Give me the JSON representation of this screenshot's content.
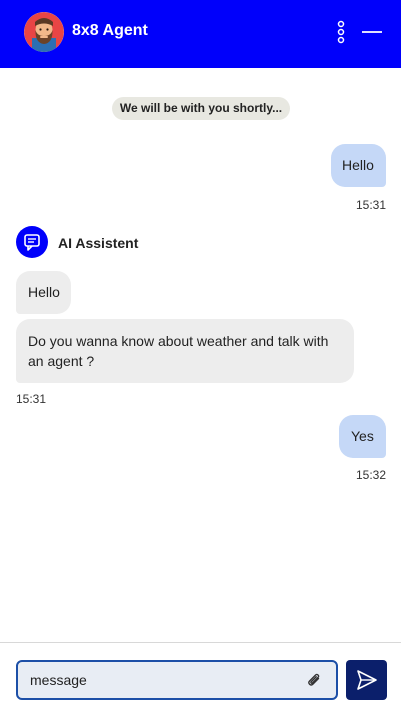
{
  "header": {
    "agent_name": "8x8 Agent",
    "avatar_icon": "bearded-man-avatar-icon",
    "menu_icon": "kebab-menu-icon",
    "minimize_icon": "minimize-icon",
    "background_color": "#0000fb"
  },
  "chat": {
    "system_message": "We will be with you shortly...",
    "messages": [
      {
        "direction": "outgoing",
        "text": "Hello",
        "time": "15:31"
      },
      {
        "direction": "incoming",
        "sender": "AI Assistent",
        "text": "Hello"
      },
      {
        "direction": "incoming",
        "sender": "AI Assistent",
        "text": "Do you wanna know about weather and talk with an agent ?",
        "time": "15:31"
      },
      {
        "direction": "outgoing",
        "text": "Yes",
        "time": "15:32"
      }
    ],
    "bot": {
      "name": "AI Assistent",
      "icon": "chat-bubble-icon"
    },
    "outgoing_color": "#c5d8f7",
    "incoming_color": "#ededed"
  },
  "composer": {
    "value": "message",
    "placeholder": "message",
    "attach_icon": "paperclip-icon",
    "send_icon": "send-icon",
    "send_color": "#0b1f6b"
  }
}
